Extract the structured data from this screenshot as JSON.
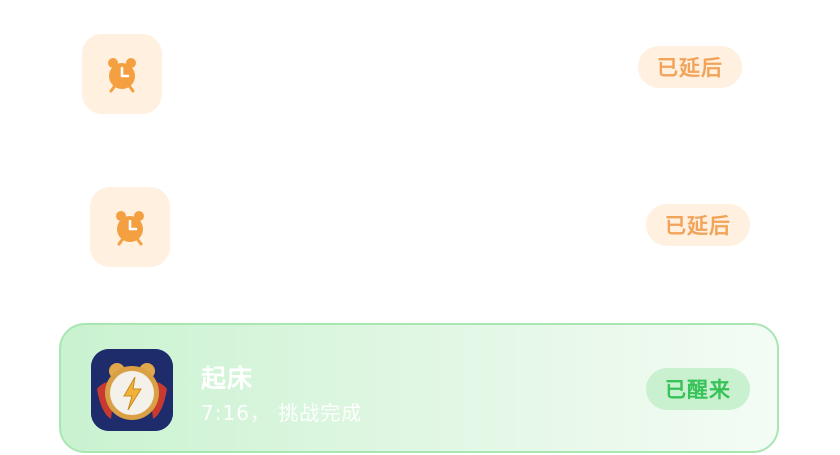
{
  "alarms": [
    {
      "status_label": "已延后",
      "icon": "alarm-clock-icon"
    },
    {
      "status_label": "已延后",
      "icon": "alarm-clock-icon"
    }
  ],
  "active_alarm": {
    "title": "起床",
    "subtitle": "7:16，  挑战完成",
    "status_label": "已醒来",
    "app_icon": "lightning-alarm-app-icon"
  },
  "colors": {
    "snoozed_bg": "#fff0e0",
    "snoozed_text": "#f2a35a",
    "awake_bg": "#c9f0cf",
    "awake_text": "#38c35a",
    "card_border": "#a8e6b2"
  }
}
